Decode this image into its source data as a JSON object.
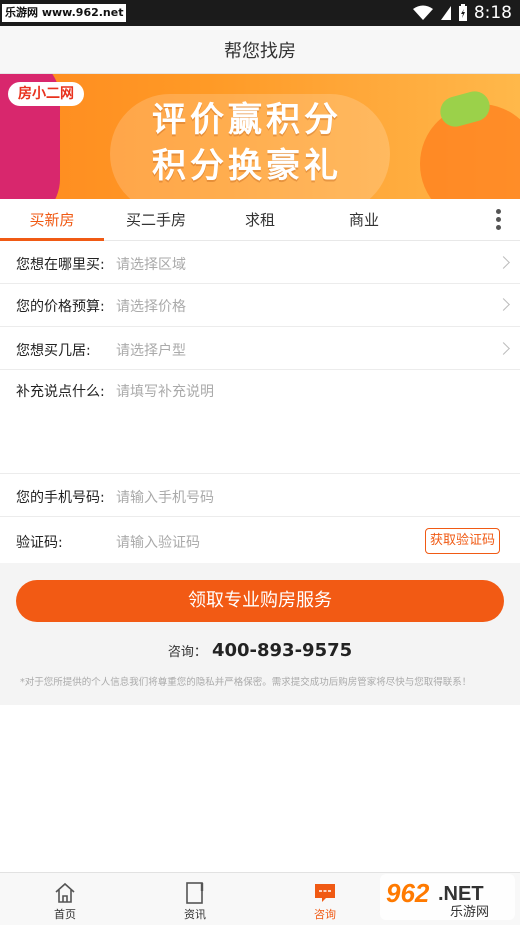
{
  "status_bar": {
    "watermark": "乐游网 www.962.net",
    "time": "8:18"
  },
  "header": {
    "title": "帮您找房"
  },
  "banner": {
    "logo_text": "房小二网",
    "line1": "评价赢积分",
    "line2": "积分换豪礼"
  },
  "tabs": [
    {
      "label": "买新房",
      "active": true
    },
    {
      "label": "买二手房"
    },
    {
      "label": "求租"
    },
    {
      "label": "商业"
    }
  ],
  "form": {
    "region": {
      "label": "您想在哪里买:",
      "placeholder": "请选择区域"
    },
    "budget": {
      "label": "您的价格预算:",
      "placeholder": "请选择价格"
    },
    "layout": {
      "label": "您想买几居:",
      "placeholder": "请选择户型"
    },
    "remarks": {
      "label": "补充说点什么:",
      "placeholder": "请填写补充说明"
    },
    "phone": {
      "label": "您的手机号码:",
      "placeholder": "请输入手机号码"
    },
    "code": {
      "label": "验证码:",
      "placeholder": "请输入验证码",
      "button": "获取验证码"
    }
  },
  "submit_label": "领取专业购房服务",
  "consult": {
    "label": "咨询：",
    "phone": "400-893-9575"
  },
  "notice": "*对于您所提供的个人信息我们将尊重您的隐私并严格保密。需求提交成功后购房管家将尽快与您取得联系！",
  "bottom_nav": [
    {
      "label": "首页",
      "icon": "home-icon"
    },
    {
      "label": "资讯",
      "icon": "document-icon"
    },
    {
      "label": "咨询",
      "icon": "chat-icon",
      "active": true
    }
  ],
  "bottom_watermark": {
    "text1": "962",
    "text2": ".NET",
    "text3": "乐游网"
  },
  "colors": {
    "accent": "#f05a14",
    "banner": "#ff9a26"
  }
}
